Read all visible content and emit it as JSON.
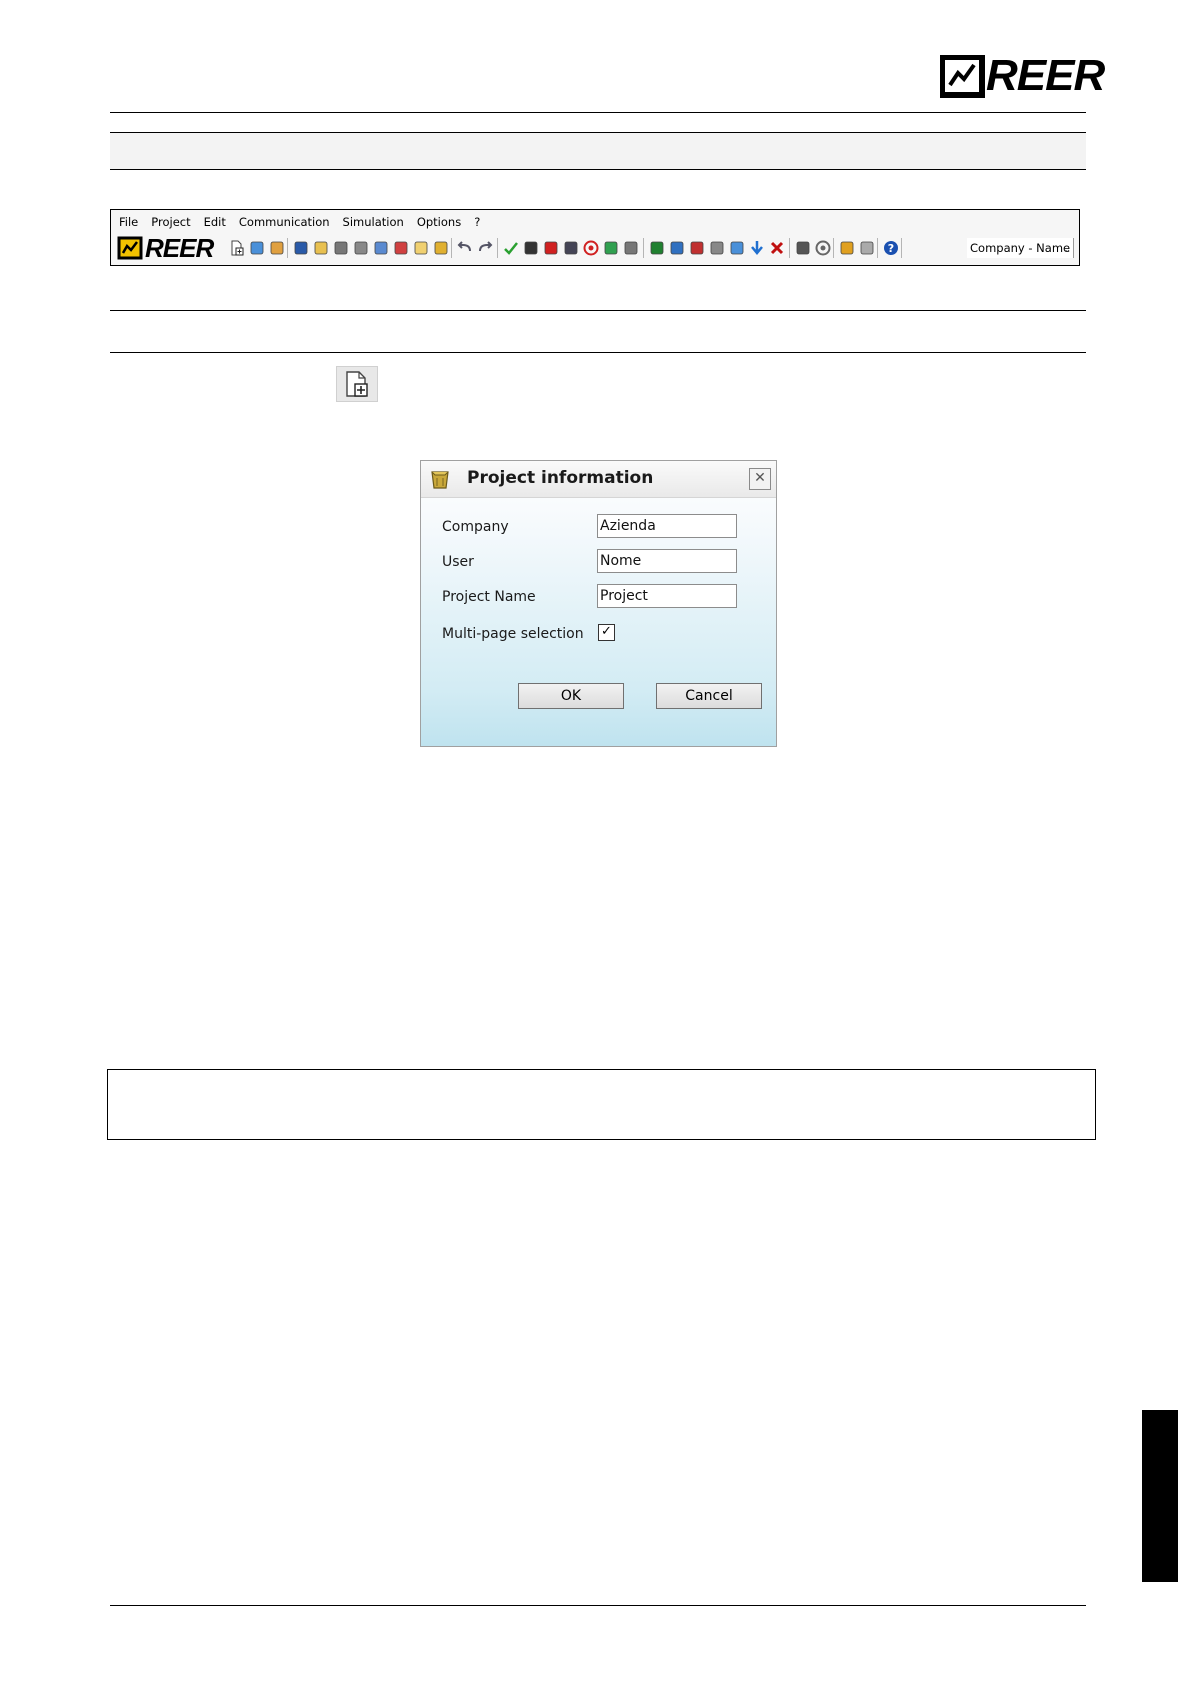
{
  "header": {
    "logo_text": "REER"
  },
  "toolbar": {
    "menu_items": [
      "File",
      "Project",
      "Edit",
      "Communication",
      "Simulation",
      "Options",
      "?"
    ],
    "logo_text": "REER",
    "company_name": "Company - Name",
    "more_glyph": "⌄",
    "icons": [
      "new-project-icon",
      "open-web-icon",
      "user-icon",
      "save-icon",
      "open-folder-icon",
      "print-icon",
      "print-preview-icon",
      "text-icon",
      "grid-icon",
      "notes-icon",
      "edit-icon",
      "undo-icon",
      "redo-icon",
      "validate-icon",
      "memory-icon",
      "shield-icon",
      "transfer-icon",
      "target-icon",
      "exchange-icon",
      "tools-icon",
      "monitor-icon",
      "zoom-icon",
      "network-icon",
      "clipboard-icon",
      "display-icon",
      "download-icon",
      "delete-icon",
      "module-icon",
      "stop-icon",
      "wizard-icon",
      "eraser-icon",
      "help-icon"
    ]
  },
  "new_project_button": {
    "icon": "new-project-icon"
  },
  "dialog": {
    "title": "Project information",
    "close_glyph": "✕",
    "fields": {
      "company_label": "Company",
      "company_value": "Azienda",
      "user_label": "User",
      "user_value": "Nome",
      "project_name_label": "Project Name",
      "project_name_value": "Project",
      "multipage_label": "Multi-page selection",
      "multipage_checked": true,
      "check_glyph": "✓"
    },
    "ok_label": "OK",
    "cancel_label": "Cancel"
  },
  "colors": {
    "dialog_gradient_bottom": "#bfe3ef",
    "band_gray": "#f3f3f3",
    "side_tab": "#000000"
  }
}
